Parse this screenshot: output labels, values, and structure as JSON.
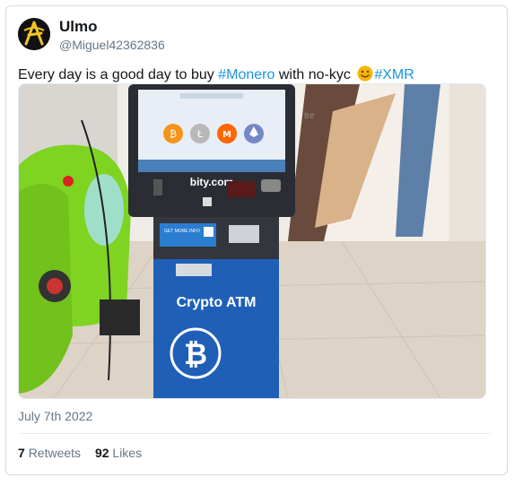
{
  "author": {
    "name": "Ulmo",
    "handle": "@Miguel42362836"
  },
  "tweet": {
    "text_before": "Every day is a good day to buy ",
    "hashtag_monero": "#Monero",
    "text_middle": " with no-kyc ",
    "emoji": "smiling-face-emoji",
    "hashtag_xmr": "#XMR"
  },
  "photo": {
    "atm_brand": "bity.com",
    "atm_label": "Crypto ATM",
    "store_sign": "tre",
    "more_info_card": "GET MORE INFO",
    "coin_icons": [
      "bitcoin-icon",
      "litecoin-icon",
      "monero-icon",
      "ethereum-icon"
    ],
    "bitcoin_symbol": "₿",
    "litecoin_symbol": "Ł",
    "monero_symbol": "M",
    "colors": {
      "atm_blue": "#1f5fb7",
      "atm_body": "#2a2d33",
      "scooter_green": "#7fd321"
    }
  },
  "date": "July 7th 2022",
  "stats": {
    "retweets_count": "7",
    "retweets_label": "Retweets",
    "likes_count": "92",
    "likes_label": "Likes"
  },
  "colors": {
    "hashtag": "#1b95e0",
    "secondary_text": "#657786"
  }
}
